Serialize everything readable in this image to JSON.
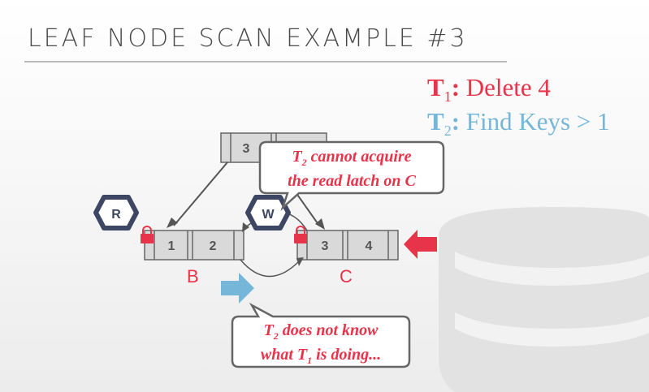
{
  "title": "LEAF NODE SCAN EXAMPLE #3",
  "legend": {
    "t1": {
      "label": "T",
      "sub": "1",
      "text": ": Delete 4"
    },
    "t2": {
      "label": "T",
      "sub": "2",
      "text": ": Find Keys > 1"
    }
  },
  "root_node": {
    "key": "3"
  },
  "leaf_b": {
    "keys": [
      "1",
      "2"
    ],
    "name": "B"
  },
  "leaf_c": {
    "keys": [
      "3",
      "4"
    ],
    "name": "C"
  },
  "latches": {
    "read": "R",
    "write": "W"
  },
  "bubble_top": {
    "line1_pre": "T",
    "line1_sub": "2",
    "line1_post": " cannot acquire",
    "line2": "the read latch on C"
  },
  "bubble_bottom": {
    "line1_pre": "T",
    "line1_sub": "2",
    "line1_post": " does not know",
    "line2_pre": "what T",
    "line2_sub": "1",
    "line2_post": " is doing..."
  },
  "colors": {
    "red": "#e8344a",
    "blue": "#76b6d9",
    "node_fill": "#d9d9d9",
    "dark": "#3d4663"
  }
}
